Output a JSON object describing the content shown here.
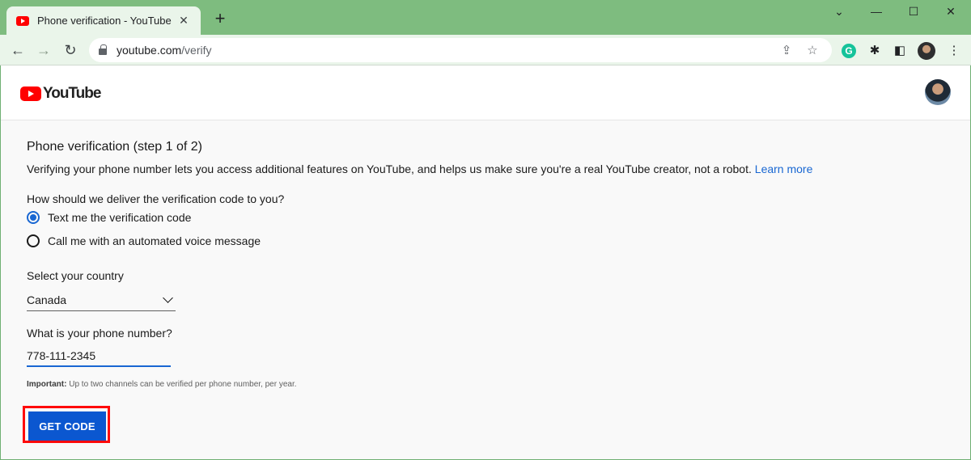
{
  "browser": {
    "tab_title": "Phone verification - YouTube",
    "tab_close": "✕",
    "new_tab": "+",
    "url_host": "youtube.com",
    "url_path": "/verify",
    "grammarly_letter": "G"
  },
  "header": {
    "logo_text": "YouTube"
  },
  "form": {
    "title": "Phone verification (step 1 of 2)",
    "description": "Verifying your phone number lets you access additional features on YouTube, and helps us make sure you're a real YouTube creator, not a robot.",
    "learn_more": "Learn more",
    "delivery_question": "How should we deliver the verification code to you?",
    "options": [
      {
        "label": "Text me the verification code",
        "checked": true
      },
      {
        "label": "Call me with an automated voice message",
        "checked": false
      }
    ],
    "country_label": "Select your country",
    "country_value": "Canada",
    "phone_label": "What is your phone number?",
    "phone_value": "778-111-2345",
    "note_bold": "Important:",
    "note_text": "Up to two channels can be verified per phone number, per year.",
    "submit_label": "GET CODE"
  },
  "colors": {
    "accent": "#0b57d0",
    "link": "#1967d2",
    "highlight": "#ff0a0a",
    "brand": "#ff0000"
  }
}
